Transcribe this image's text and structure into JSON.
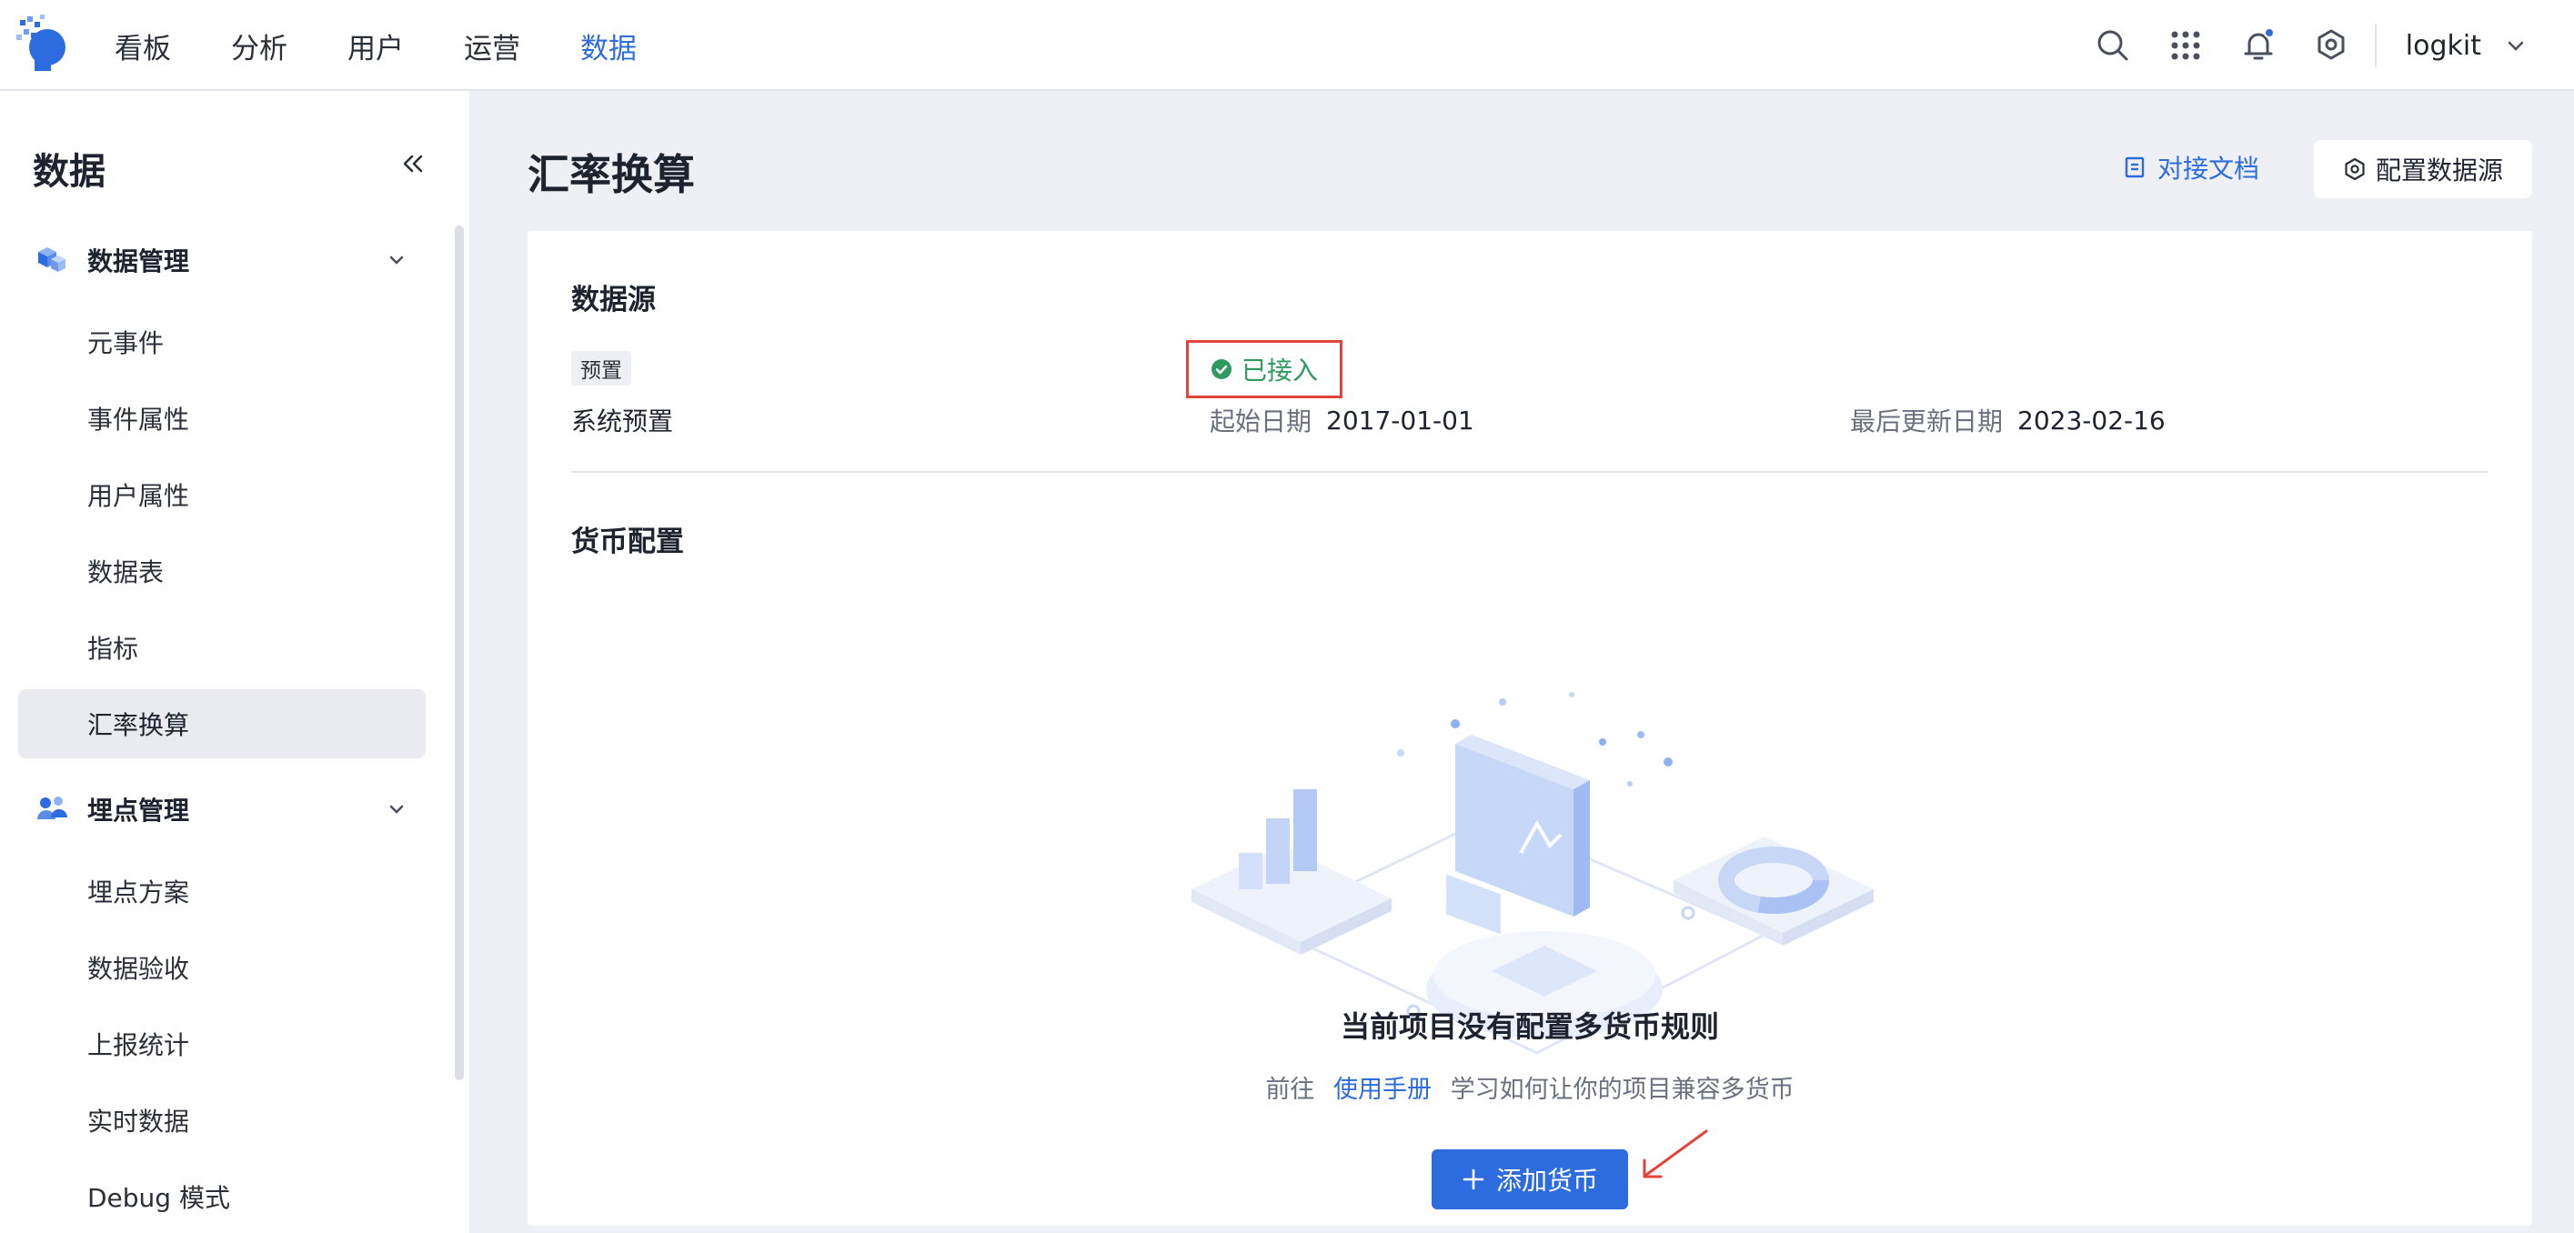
{
  "nav": {
    "items": [
      "看板",
      "分析",
      "用户",
      "运营",
      "数据"
    ],
    "active_index": 4
  },
  "header_right": {
    "icons": [
      "search-icon",
      "apps-grid-icon",
      "bell-icon",
      "settings-icon"
    ],
    "user_name": "logkit"
  },
  "sidebar": {
    "title": "数据",
    "groups": [
      {
        "label": "数据管理",
        "icon": "data-cube-icon",
        "items": [
          "元事件",
          "事件属性",
          "用户属性",
          "数据表",
          "指标",
          "汇率换算"
        ],
        "active_item": 5
      },
      {
        "label": "埋点管理",
        "icon": "tracking-people-icon",
        "items": [
          "埋点方案",
          "数据验收",
          "上报统计",
          "实时数据",
          "Debug 模式"
        ]
      }
    ]
  },
  "main": {
    "title": "汇率换算",
    "doc_link": "对接文档",
    "config_button": "配置数据源",
    "datasource": {
      "section_title": "数据源",
      "tag": "预置",
      "name": "系统预置",
      "status": "已接入",
      "start_label": "起始日期",
      "start_value": "2017-01-01",
      "updated_label": "最后更新日期",
      "updated_value": "2023-02-16"
    },
    "currency": {
      "section_title": "货币配置",
      "empty_title": "当前项目没有配置多货币规则",
      "empty_prefix": "前往",
      "empty_link": "使用手册",
      "empty_suffix": "学习如何让你的项目兼容多货币",
      "add_button": "添加货币"
    }
  },
  "colors": {
    "accent": "#2d6cdf",
    "status_green": "#2e9a5f",
    "highlight_red": "#e0443a",
    "page_bg": "#eef0f5"
  }
}
